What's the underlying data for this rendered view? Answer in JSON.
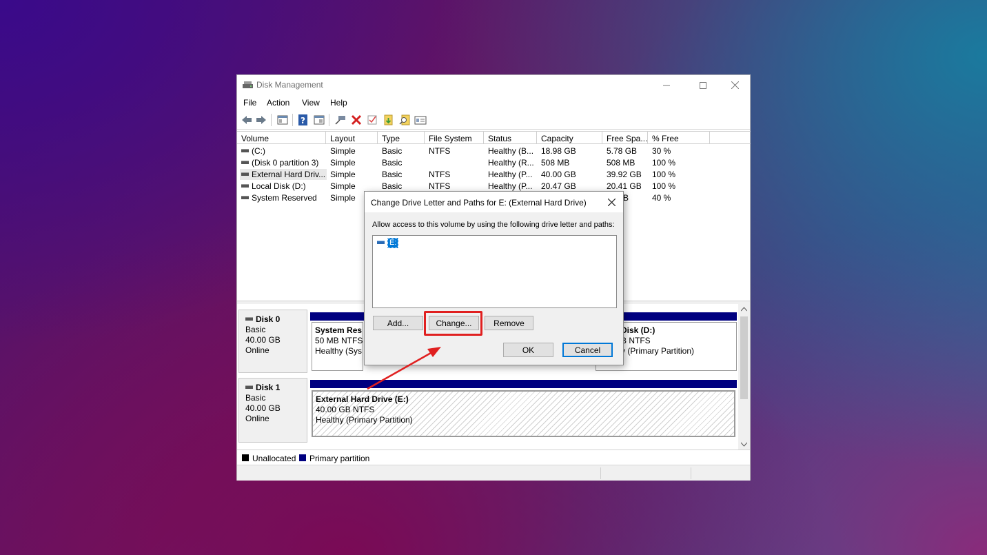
{
  "window": {
    "title": "Disk Management",
    "minimize_icon": "minimize-icon",
    "maximize_icon": "maximize-icon",
    "close_icon": "close-icon"
  },
  "menu": [
    "File",
    "Action",
    "View",
    "Help"
  ],
  "toolbar_icons": [
    "back-arrow-icon",
    "forward-arrow-icon",
    "console-tree-icon",
    "help-icon",
    "properties-icon",
    "connect-icon",
    "delete-icon",
    "check-icon",
    "import-icon",
    "search-icon",
    "show-panel-icon"
  ],
  "table": {
    "columns": [
      "Volume",
      "Layout",
      "Type",
      "File System",
      "Status",
      "Capacity",
      "Free Spa...",
      "% Free"
    ],
    "rows": [
      [
        "(C:)",
        "Simple",
        "Basic",
        "NTFS",
        "Healthy (B...",
        "18.98 GB",
        "5.78 GB",
        "30 %"
      ],
      [
        "(Disk 0 partition 3)",
        "Simple",
        "Basic",
        "",
        "Healthy (R...",
        "508 MB",
        "508 MB",
        "100 %"
      ],
      [
        "External Hard Driv...",
        "Simple",
        "Basic",
        "NTFS",
        "Healthy (P...",
        "40.00 GB",
        "39.92 GB",
        "100 %"
      ],
      [
        "Local Disk (D:)",
        "Simple",
        "Basic",
        "NTFS",
        "Healthy (P...",
        "20.47 GB",
        "20.41 GB",
        "100 %"
      ],
      [
        "System Reserved",
        "Simple",
        "",
        "",
        "",
        "",
        "B",
        "40 %"
      ]
    ]
  },
  "disks": [
    {
      "name": "Disk 0",
      "type": "Basic",
      "size": "40.00 GB",
      "state": "Online",
      "partitions": [
        {
          "name": "System Res",
          "info": "50 MB NTFS",
          "status": "Healthy (Sys"
        },
        {
          "name": "Disk  (D:)",
          "info": "B NTFS",
          "status": "y (Primary Partition)"
        }
      ]
    },
    {
      "name": "Disk 1",
      "type": "Basic",
      "size": "40.00 GB",
      "state": "Online",
      "partitions": [
        {
          "name": "External Hard Drive  (E:)",
          "info": "40.00 GB NTFS",
          "status": "Healthy (Primary Partition)"
        }
      ]
    }
  ],
  "legend": {
    "unallocated": "Unallocated",
    "primary": "Primary partition",
    "unallocated_color": "#000000",
    "primary_color": "#000080"
  },
  "dialog": {
    "title": "Change Drive Letter and Paths for E: (External Hard Drive)",
    "prompt": "Allow access to this volume by using the following drive letter and paths:",
    "entry": "E:",
    "add": "Add...",
    "change": "Change...",
    "remove": "Remove",
    "ok": "OK",
    "cancel": "Cancel"
  },
  "annotation": {
    "highlight_color": "#e02020"
  }
}
